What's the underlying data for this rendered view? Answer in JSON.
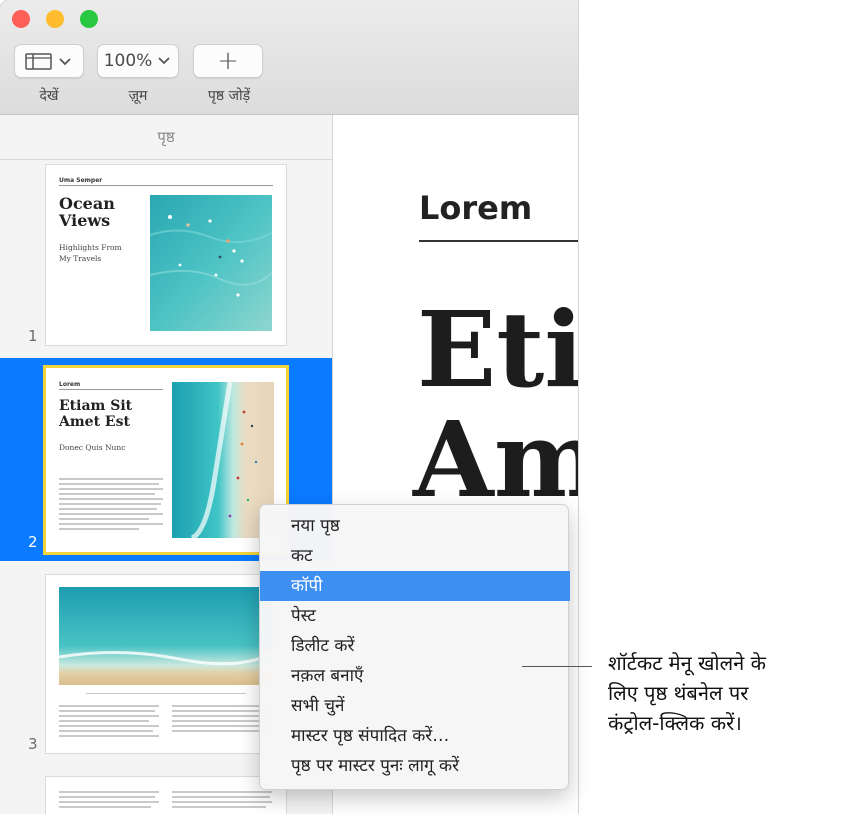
{
  "toolbar": {
    "view_label": "देखें",
    "zoom_value": "100%",
    "zoom_label": "ज़ूम",
    "add_page_label": "पृष्ठ जोड़ें",
    "add_glyph": "+"
  },
  "sidebar": {
    "header": "पृष्ठ",
    "pages": [
      {
        "number": "1",
        "author": "Uma Semper",
        "title": [
          "Ocean",
          "Views"
        ],
        "subtitle": [
          "Highlights From",
          "My Travels"
        ]
      },
      {
        "number": "2",
        "author": "Lorem",
        "title": [
          "Etiam Sit",
          "Amet Est"
        ],
        "subtitle": [
          "Donec Quis Nunc"
        ]
      },
      {
        "number": "3"
      }
    ]
  },
  "canvas": {
    "header": "Lorem",
    "big_line1": "Etia",
    "big_line2": "Am"
  },
  "context_menu": {
    "items": [
      "नया पृष्ठ",
      "कट",
      "कॉपी",
      "पेस्ट",
      "डिलीट करें",
      "नक़ल बनाएँ",
      "सभी चुनें",
      "मास्टर पृष्ठ संपादित करें…",
      "पृष्ठ पर मास्टर पुनः लागू करें"
    ],
    "highlighted_index": 2
  },
  "callout": {
    "line1": "शॉर्टकट मेनू खोलने के",
    "line2": "लिए पृष्ठ थंबनेल पर",
    "line3": "कंट्रोल-क्लिक करें।"
  },
  "colors": {
    "selection": "#0a7aff",
    "menu_highlight": "#3d8ff2",
    "thumb_border_selected": "#f3d33a",
    "close": "#fe5f57",
    "minimize": "#febc2e",
    "zoom": "#28c840"
  }
}
